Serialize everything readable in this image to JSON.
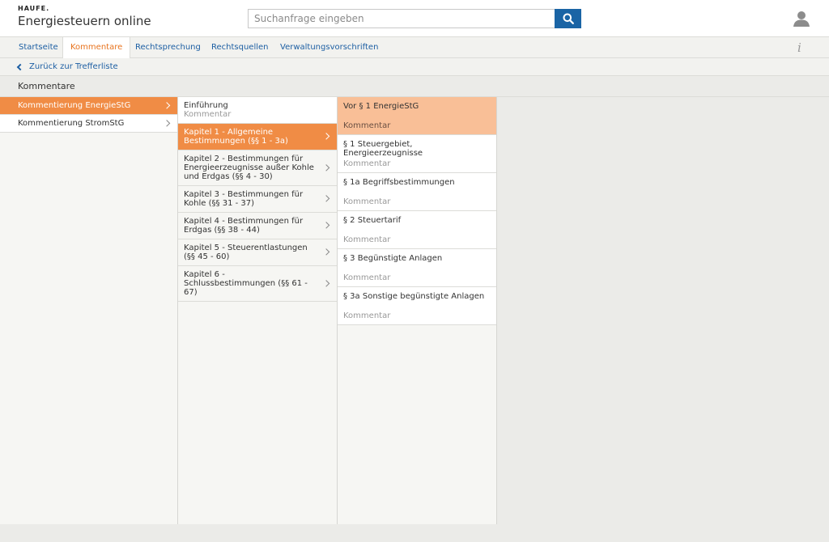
{
  "header": {
    "brand": "HAUFE.",
    "app_title": "Energiesteuern online",
    "search_placeholder": "Suchanfrage eingeben"
  },
  "nav": {
    "tabs": [
      "Startseite",
      "Kommentare",
      "Rechtsprechung",
      "Rechtsquellen",
      "Verwaltungsvorschriften"
    ],
    "active": "Kommentare",
    "info_label": "i"
  },
  "back": {
    "label": "Zurück zur Trefferliste"
  },
  "section": {
    "title": "Kommentare"
  },
  "col1": {
    "items": [
      "Kommentierung EnergieStG",
      "Kommentierung StromStG"
    ]
  },
  "col2": {
    "intro_title": "Einführung",
    "intro_sub": "Kommentar",
    "items": [
      "Kapitel 1 - Allgemeine Bestimmungen (§§ 1 - 3a)",
      "Kapitel 2 - Bestimmungen für Energieerzeugnisse außer Kohle und Erdgas (§§ 4 - 30)",
      "Kapitel 3 - Bestimmungen für Kohle (§§ 31 - 37)",
      "Kapitel 4 - Bestimmungen für Erdgas (§§ 38 - 44)",
      "Kapitel 5 - Steuerentlastungen (§§ 45 - 60)",
      "Kapitel 6 - Schlussbestimmungen (§§ 61 - 67)"
    ]
  },
  "col3": {
    "items": [
      {
        "title": "Vor § 1 EnergieStG",
        "sub": "Kommentar"
      },
      {
        "title": "§ 1 Steuergebiet, Energieerzeugnisse",
        "sub": "Kommentar"
      },
      {
        "title": "§ 1a Begriffsbestimmungen",
        "sub": "Kommentar"
      },
      {
        "title": "§ 2 Steuertarif",
        "sub": "Kommentar"
      },
      {
        "title": "§ 3 Begünstigte Anlagen",
        "sub": "Kommentar"
      },
      {
        "title": "§ 3a Sonstige begünstigte Anlagen",
        "sub": "Kommentar"
      }
    ]
  },
  "colors": {
    "accent": "#f08c45",
    "accent_light": "#f9bf97",
    "link": "#1d5fa3",
    "nav_active": "#e8741f",
    "search_button": "#1a64a5"
  },
  "icons": {
    "search": "search-icon",
    "user": "user-icon",
    "info": "info-icon",
    "back": "chevron-left-icon",
    "item": "chevron-right-icon"
  }
}
